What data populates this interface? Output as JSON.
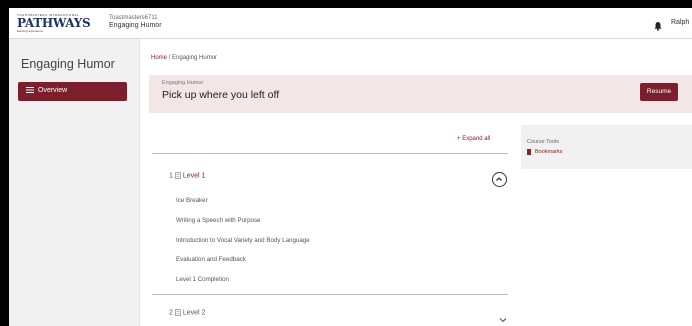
{
  "header": {
    "logo_tiny": "TOASTMASTERS INTERNATIONAL",
    "logo_brand": "PATHWAYS",
    "logo_sub": "learning experience",
    "username_line": "Toastmasters6711",
    "course_line": "Engaging Humor",
    "user_name": "Ralph"
  },
  "sidebar": {
    "title": "Engaging Humor",
    "overview_label": "Overview"
  },
  "breadcrumb": {
    "home": "Home",
    "separator": "/",
    "current": "Engaging Humor"
  },
  "resume": {
    "eyebrow": "Engaging Humor",
    "heading": "Pick up where you left off",
    "button": "Resume"
  },
  "outline": {
    "expand_all": "Expand all",
    "level1": {
      "number": "1",
      "label": "Level 1"
    },
    "lessons": [
      "Ice Breaker",
      "Writing a Speech with Purpose",
      "Introduction to Vocal Variety and Body Language",
      "Evaluation and Feedback",
      "Level 1 Completion"
    ],
    "level2": {
      "number": "2",
      "label": "Level 2"
    }
  },
  "course_tools": {
    "title": "Course Tools",
    "bookmarks": "Bookmarks"
  },
  "colors": {
    "accent": "#7a1f2b",
    "accent_text": "#8a1e2a",
    "resume_bg": "#f2e6e7"
  }
}
